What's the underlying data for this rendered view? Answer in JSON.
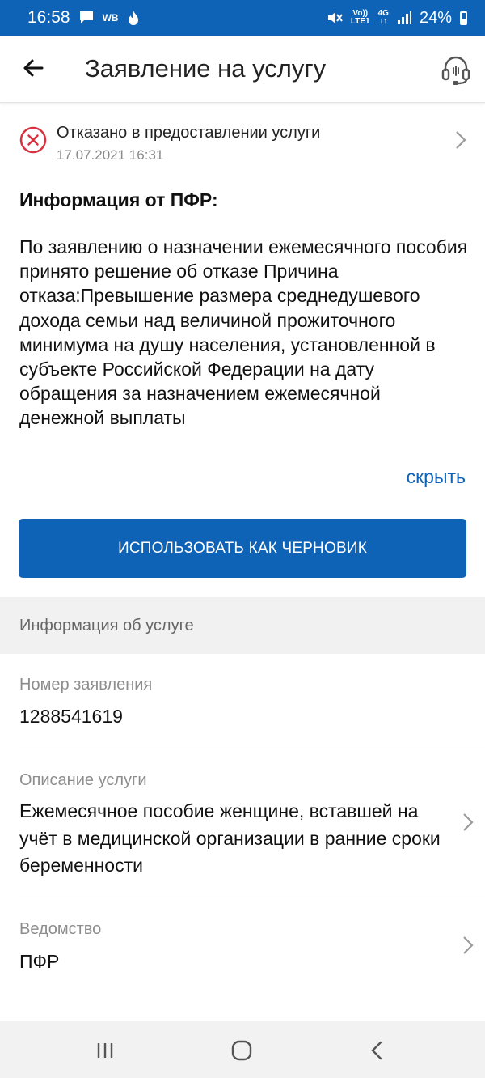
{
  "status_bar": {
    "time": "16:58",
    "left_text": "WB",
    "volte_top": "Vo))",
    "volte_bottom": "LTE1",
    "network_top": "4G",
    "network_bottom": "↓↑",
    "battery": "24%"
  },
  "app_bar": {
    "title": "Заявление на услугу",
    "back_icon": "arrow-left-icon",
    "support_icon": "headset-icon"
  },
  "status": {
    "title": "Отказано в предоставлении услуги",
    "date": "17.07.2021 16:31",
    "icon": "cross-circle-icon",
    "icon_color": "#d9323f"
  },
  "pfr_info": {
    "heading": "Информация от ПФР:",
    "text": "По заявлению о назначении ежемесячного пособия принято решение об отказе Причина отказа:Превышение размера среднедушевого дохода семьи над величиной прожиточного минимума на душу населения, установленной в субъекте Российской Федерации на дату обращения за назначением ежемесячной денежной выплаты",
    "hide_link": "скрыть"
  },
  "primary_button": {
    "label": "ИСПОЛЬЗОВАТЬ КАК ЧЕРНОВИК"
  },
  "service_info": {
    "header": "Информация об услуге",
    "fields": [
      {
        "label": "Номер заявления",
        "value": "1288541619"
      },
      {
        "label": "Описание услуги",
        "value": "Ежемесячное пособие женщине, вставшей на учёт в медицинской организации в ранние сроки беременности"
      },
      {
        "label": "Ведомство",
        "value": "ПФР"
      }
    ]
  },
  "nav_bar": {
    "recent_icon": "recent-apps-icon",
    "home_icon": "home-icon",
    "back_icon": "back-chevron-icon"
  },
  "colors": {
    "accent": "#0e63b7",
    "error": "#d9323f"
  }
}
